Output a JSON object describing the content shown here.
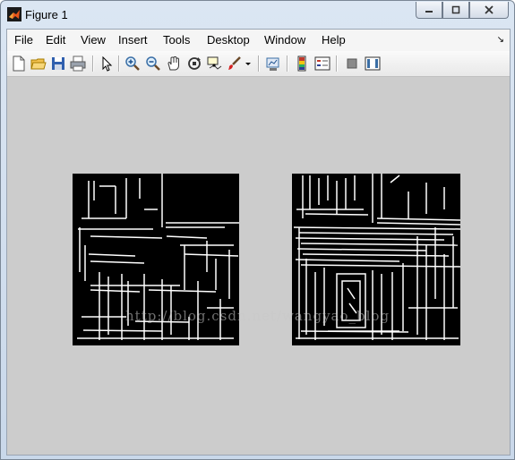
{
  "window": {
    "title": "Figure 1"
  },
  "menu": {
    "items": [
      "File",
      "Edit",
      "View",
      "Insert",
      "Tools",
      "Desktop",
      "Window",
      "Help"
    ]
  },
  "toolbar": {
    "icons": [
      "new-figure-icon",
      "open-icon",
      "save-icon",
      "print-icon",
      "edit-plot-arrow-icon",
      "zoom-in-icon",
      "zoom-out-icon",
      "pan-hand-icon",
      "rotate-3d-icon",
      "data-cursor-icon",
      "brush-icon",
      "brush-dropdown-icon",
      "link-plot-icon",
      "colorbar-icon",
      "legend-icon",
      "hide-plot-tools-icon",
      "show-plot-tools-icon"
    ]
  },
  "figure": {
    "background": "#cccccc",
    "axes": [
      "left-edge-image",
      "right-edge-image"
    ]
  },
  "watermark": "http://blog.csdn.net/wangyao_blog"
}
